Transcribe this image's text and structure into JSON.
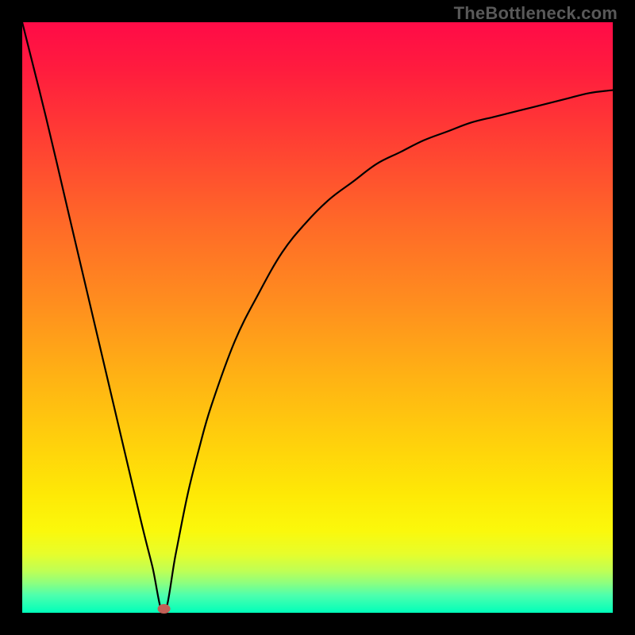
{
  "watermark": "TheBottleneck.com",
  "colors": {
    "frame": "#000000",
    "gradient_top": "#ff0b47",
    "gradient_bottom": "#00ffba",
    "curve": "#000000",
    "min_point": "#c25f56"
  },
  "chart_data": {
    "type": "line",
    "title": "",
    "xlabel": "",
    "ylabel": "",
    "xlim": [
      0,
      100
    ],
    "ylim": [
      0,
      100
    ],
    "min_x": 24,
    "series": [
      {
        "name": "bottleneck-curve",
        "x": [
          0,
          4,
          8,
          12,
          16,
          20,
          22,
          24,
          26,
          28,
          30,
          32,
          36,
          40,
          44,
          48,
          52,
          56,
          60,
          64,
          68,
          72,
          76,
          80,
          84,
          88,
          92,
          96,
          100
        ],
        "values": [
          100,
          84,
          67,
          50,
          33,
          16,
          8,
          0,
          10,
          20,
          28,
          35,
          46,
          54,
          61,
          66,
          70,
          73,
          76,
          78,
          80,
          81.5,
          83,
          84,
          85,
          86,
          87,
          88,
          88.5
        ]
      }
    ]
  }
}
